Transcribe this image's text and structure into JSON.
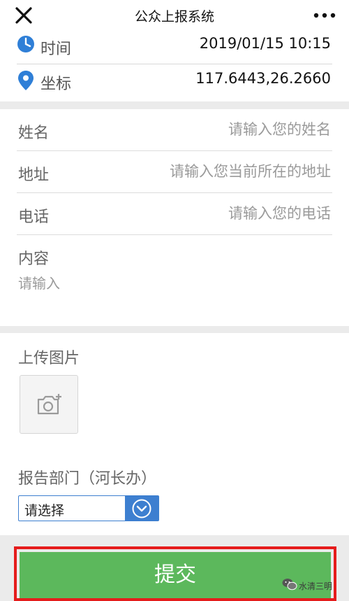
{
  "header": {
    "title": "公众上报系统"
  },
  "info": {
    "time_label": "时间",
    "time_value": "2019/01/15 10:15",
    "coord_label": "坐标",
    "coord_value": "117.6443,26.2660"
  },
  "form": {
    "name_label": "姓名",
    "name_placeholder": "请输入您的姓名",
    "address_label": "地址",
    "address_placeholder": "请输入您当前所在的地址",
    "phone_label": "电话",
    "phone_placeholder": "请输入您的电话",
    "content_label": "内容",
    "content_placeholder": "请输入"
  },
  "upload": {
    "label": "上传图片",
    "dept_label": "报告部门（河长办）",
    "select_value": "请选择"
  },
  "submit_label": "提交",
  "watermark": {
    "text": "水清三明"
  },
  "colors": {
    "submit_green": "#5cb85c",
    "highlight_red": "#e51c1c",
    "icon_blue": "#2f7fd7",
    "select_blue": "#3d7fd0"
  }
}
